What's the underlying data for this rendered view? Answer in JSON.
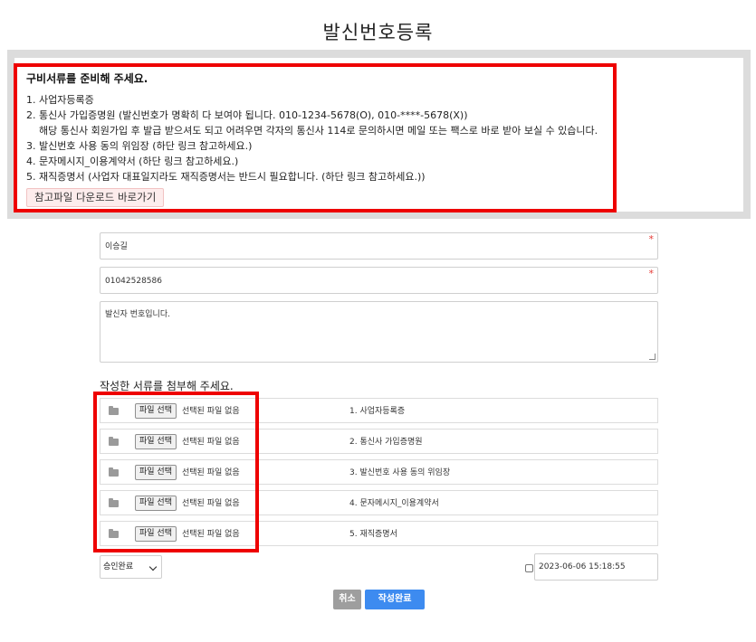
{
  "page": {
    "title": "발신번호등록"
  },
  "notice": {
    "heading": "구비서류를 준비해 주세요.",
    "lines": [
      "1. 사업자등록증",
      "2. 통신사 가입증명원 (발신번호가 명확히 다 보여야 됩니다. 010-1234-5678(O), 010-****-5678(X))",
      "해당 통신사 회원가입 후 발급 받으셔도 되고 어려우면 각자의 통신사 114로 문의하시면 메일 또는 팩스로 바로 받아 보실 수 있습니다.",
      "3. 발신번호 사용 동의 위임장 (하단 링크 참고하세요.)",
      "4. 문자메시지_이용계약서 (하단 링크 참고하세요.)",
      "5. 재직증명서 (사업자 대표일지라도 재직증명서는 반드시 필요합니다. (하단 링크 참고하세요.))"
    ],
    "download_label": "참고파일 다운로드 바로가기"
  },
  "form": {
    "name_value": "이승길",
    "phone_value": "01042528586",
    "memo_value": "발신자 번호입니다.",
    "required_mark": "*"
  },
  "attachments": {
    "title": "작성한 서류를 첨부해 주세요.",
    "choose_label": "파일 선택",
    "no_file_label": "선택된 파일 없음",
    "items": [
      "1. 사업자등록증",
      "2. 통신사 가입증명원",
      "3. 발신번호 사용 동의 위임장",
      "4. 문자메시지_이용계약서",
      "5. 재직증명서"
    ]
  },
  "status": {
    "selected": "승인완료"
  },
  "date": {
    "value": "2023-06-06 15:18:55"
  },
  "buttons": {
    "cancel": "취소",
    "submit": "작성완료"
  },
  "colors": {
    "highlight": "#ee0000",
    "submit": "#3d8bf0",
    "cancel": "#9e9e9e",
    "download_bg": "#fdecec"
  }
}
